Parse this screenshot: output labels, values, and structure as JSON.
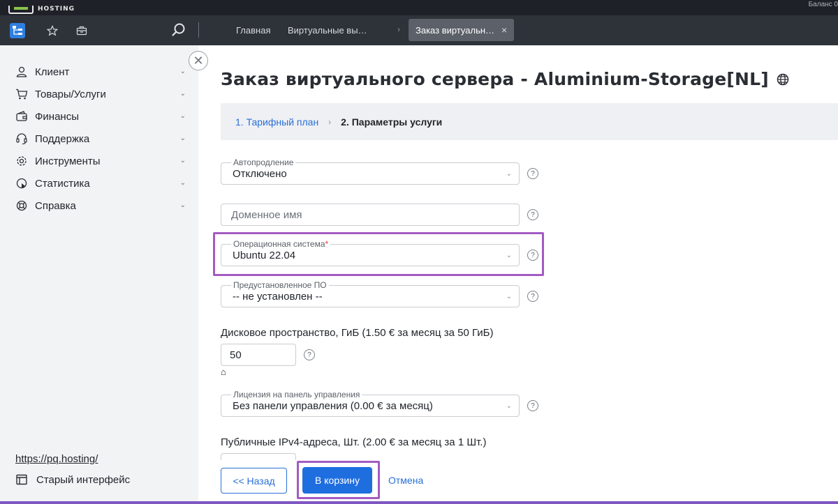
{
  "header": {
    "logo_text": "HOSTING",
    "right_text": "Баланс 0"
  },
  "navbar": {
    "tabs": [
      "Главная",
      "Виртуальные вы…",
      "Заказ виртуальн…"
    ],
    "close_glyph": "×",
    "breadcrumb_sep": "›"
  },
  "sidebar": {
    "items": [
      {
        "label": "Клиент",
        "icon": "user-icon"
      },
      {
        "label": "Товары/Услуги",
        "icon": "cart-icon"
      },
      {
        "label": "Финансы",
        "icon": "wallet-icon"
      },
      {
        "label": "Поддержка",
        "icon": "headset-icon"
      },
      {
        "label": "Инструменты",
        "icon": "gear-icon"
      },
      {
        "label": "Статистика",
        "icon": "pie-chart-icon"
      },
      {
        "label": "Справка",
        "icon": "lifebuoy-icon"
      }
    ],
    "site_link": "https://pq.hosting/",
    "old_interface": "Старый интерфейс"
  },
  "main": {
    "title": "Заказ виртуального сервера - Aluminium-Storage[NL]",
    "steps": {
      "step1": "1. Тарифный план",
      "step2": "2. Параметры услуги"
    },
    "autorenew": {
      "label": "Автопродление",
      "value": "Отключено"
    },
    "domain": {
      "placeholder": "Доменное имя"
    },
    "os": {
      "label": "Операционная система",
      "required_mark": "*",
      "value": "Ubuntu 22.04"
    },
    "preinstalled": {
      "label": "Предустановленное ПО",
      "value": "-- не установлен --"
    },
    "disk": {
      "label": "Дисковое пространство, ГиБ (1.50 € за месяц за 50 ГиБ)",
      "value": "50"
    },
    "panel_license": {
      "label": "Лицензия на панель управления",
      "value": "Без панели управления (0.00 € за месяц)"
    },
    "ipv4": {
      "label": "Публичные IPv4-адреса, Шт. (2.00 € за месяц за 1 Шт.)"
    },
    "help_glyph": "?",
    "buttons": {
      "back": "<< Назад",
      "cart": "В корзину",
      "cancel": "Отмена"
    }
  },
  "colors": {
    "accent": "#1f6ee0",
    "highlight": "#a25bc2",
    "sidebar_bg": "#f2f3f5",
    "navbar_bg": "#2e3239"
  }
}
